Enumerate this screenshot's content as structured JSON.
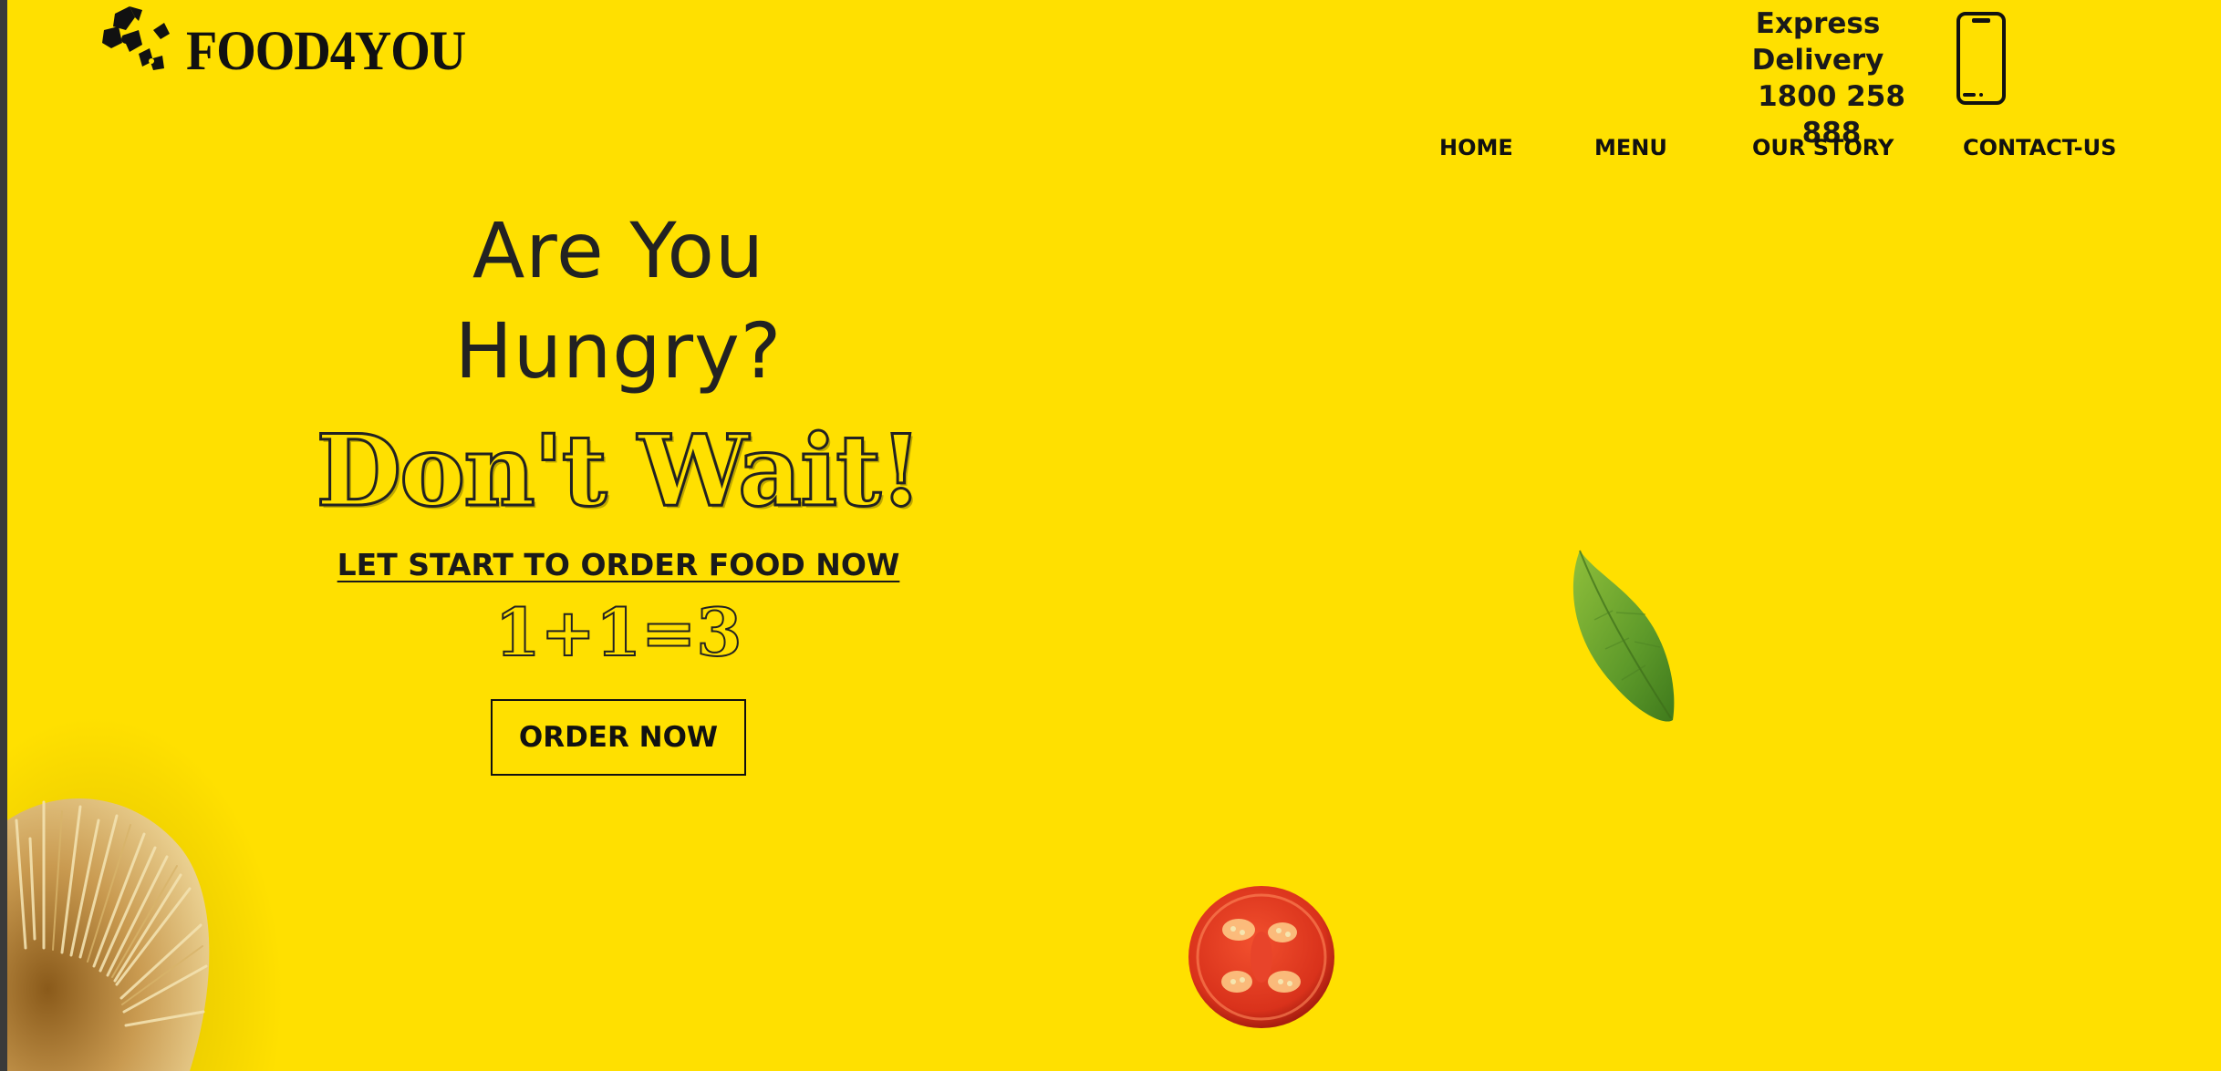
{
  "brand": {
    "name": "FOOD4YOU",
    "logo_icon": "bowtie-chef-icon"
  },
  "header": {
    "express_title": "Express Delivery",
    "express_phone": "1800 258 888",
    "phone_icon": "smartphone-icon"
  },
  "nav": {
    "items": [
      {
        "label": "HOME"
      },
      {
        "label": "MENU"
      },
      {
        "label": "OUR STORY"
      },
      {
        "label": "CONTACT-US"
      }
    ]
  },
  "hero": {
    "question": "Are You Hungry?",
    "headline": "Don't Wait!",
    "subheading": "LET START TO ORDER FOOD NOW",
    "offer": "1+1=3",
    "cta_label": "ORDER NOW"
  },
  "decorations": {
    "basil": "basil-leaf-image",
    "tomato": "tomato-slice-image",
    "pasta": "spaghetti-bundle-image"
  },
  "colors": {
    "background": "#ffe000",
    "text": "#111111"
  }
}
